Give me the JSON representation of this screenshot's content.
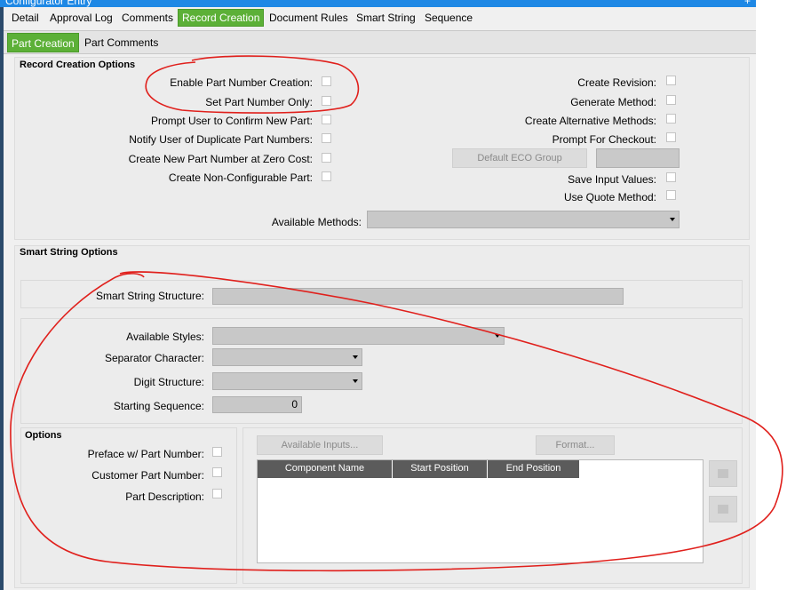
{
  "window": {
    "title": "Configurator Entry",
    "plus_glyph": "+"
  },
  "tabs": [
    "Detail",
    "Approval Log",
    "Comments",
    "Record Creation",
    "Document Rules",
    "Smart String",
    "Sequence"
  ],
  "subtabs": [
    "Part Creation",
    "Part Comments"
  ],
  "record_creation": {
    "title": "Record Creation Options",
    "left_options": [
      {
        "label": "Enable Part Number Creation:",
        "checked": false
      },
      {
        "label": "Set Part Number Only:",
        "checked": false
      },
      {
        "label": "Prompt User to Confirm New Part:",
        "checked": false
      },
      {
        "label": "Notify User of Duplicate Part Numbers:",
        "checked": false
      },
      {
        "label": "Create New Part Number at Zero Cost:",
        "checked": false
      },
      {
        "label": "Create Non-Configurable Part:",
        "checked": false
      }
    ],
    "right_options": [
      {
        "label": "Create Revision:",
        "checked": false
      },
      {
        "label": "Generate Method:",
        "checked": false
      },
      {
        "label": "Create Alternative Methods:",
        "checked": false
      },
      {
        "label": "Prompt For Checkout:",
        "checked": false
      },
      {
        "label": "Save Input Values:",
        "checked": false
      },
      {
        "label": "Use Quote Method:",
        "checked": false
      }
    ],
    "default_eco_group_button": "Default ECO Group",
    "available_methods_label": "Available Methods:",
    "available_methods_value": ""
  },
  "smart_string": {
    "title": "Smart String Options",
    "structure_label": "Smart String Structure:",
    "structure_value": "",
    "available_styles_label": "Available Styles:",
    "separator_label": "Separator Character:",
    "digit_structure_label": "Digit Structure:",
    "starting_sequence_label": "Starting Sequence:",
    "starting_sequence_value": "0",
    "options_title": "Options",
    "options": [
      {
        "label": "Preface w/ Part Number:",
        "checked": false
      },
      {
        "label": "Customer Part Number:",
        "checked": false
      },
      {
        "label": "Part Description:",
        "checked": false
      }
    ],
    "available_inputs_button": "Available Inputs...",
    "format_button": "Format...",
    "grid_columns": [
      "Component Name",
      "Start Position",
      "End Position"
    ]
  },
  "colors": {
    "active_tab": "#5cb037",
    "titlebar": "#1e88e5",
    "annotation": "#e0201c"
  }
}
